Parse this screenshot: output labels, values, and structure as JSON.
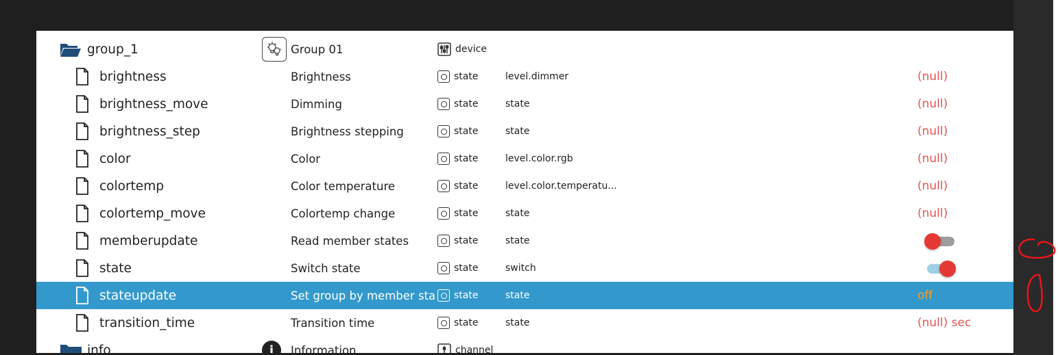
{
  "group": {
    "name": "group_1",
    "description": "Group 01",
    "type": "device"
  },
  "rows": [
    {
      "name": "brightness",
      "description": "Brightness",
      "type": "state",
      "role": "level.dimmer",
      "value": "(null)"
    },
    {
      "name": "brightness_move",
      "description": "Dimming",
      "type": "state",
      "role": "state",
      "value": "(null)"
    },
    {
      "name": "brightness_step",
      "description": "Brightness stepping",
      "type": "state",
      "role": "state",
      "value": "(null)"
    },
    {
      "name": "color",
      "description": "Color",
      "type": "state",
      "role": "level.color.rgb",
      "value": "(null)"
    },
    {
      "name": "colortemp",
      "description": "Color temperature",
      "type": "state",
      "role": "level.color.temperatu...",
      "value": "(null)"
    },
    {
      "name": "colortemp_move",
      "description": "Colortemp change",
      "type": "state",
      "role": "state",
      "value": "(null)"
    },
    {
      "name": "memberupdate",
      "description": "Read member states",
      "type": "state",
      "role": "state",
      "toggle": false
    },
    {
      "name": "state",
      "description": "Switch state",
      "type": "state",
      "role": "switch",
      "toggle": true
    },
    {
      "name": "stateupdate",
      "description": "Set group by member sta...",
      "type": "state",
      "role": "state",
      "value": "off",
      "selected": true
    },
    {
      "name": "transition_time",
      "description": "Transition time",
      "type": "state",
      "role": "state",
      "value": "(null) sec"
    }
  ],
  "info": {
    "name": "info",
    "description": "Information",
    "type": "channel"
  },
  "colors": {
    "selected_row": "#3399cc",
    "null_value": "#e55353",
    "off_value": "#f0a030",
    "folder": "#1f4e79",
    "toggle_thumb": "#e53935",
    "annotation": "#e8161b"
  },
  "icons": {
    "folder": "folder-open-icon",
    "file": "file-icon",
    "device": "lightbulb-group-icon",
    "device_type": "sliders-icon",
    "state_type": "state-icon",
    "info": "info-icon",
    "channel_type": "channel-icon"
  }
}
